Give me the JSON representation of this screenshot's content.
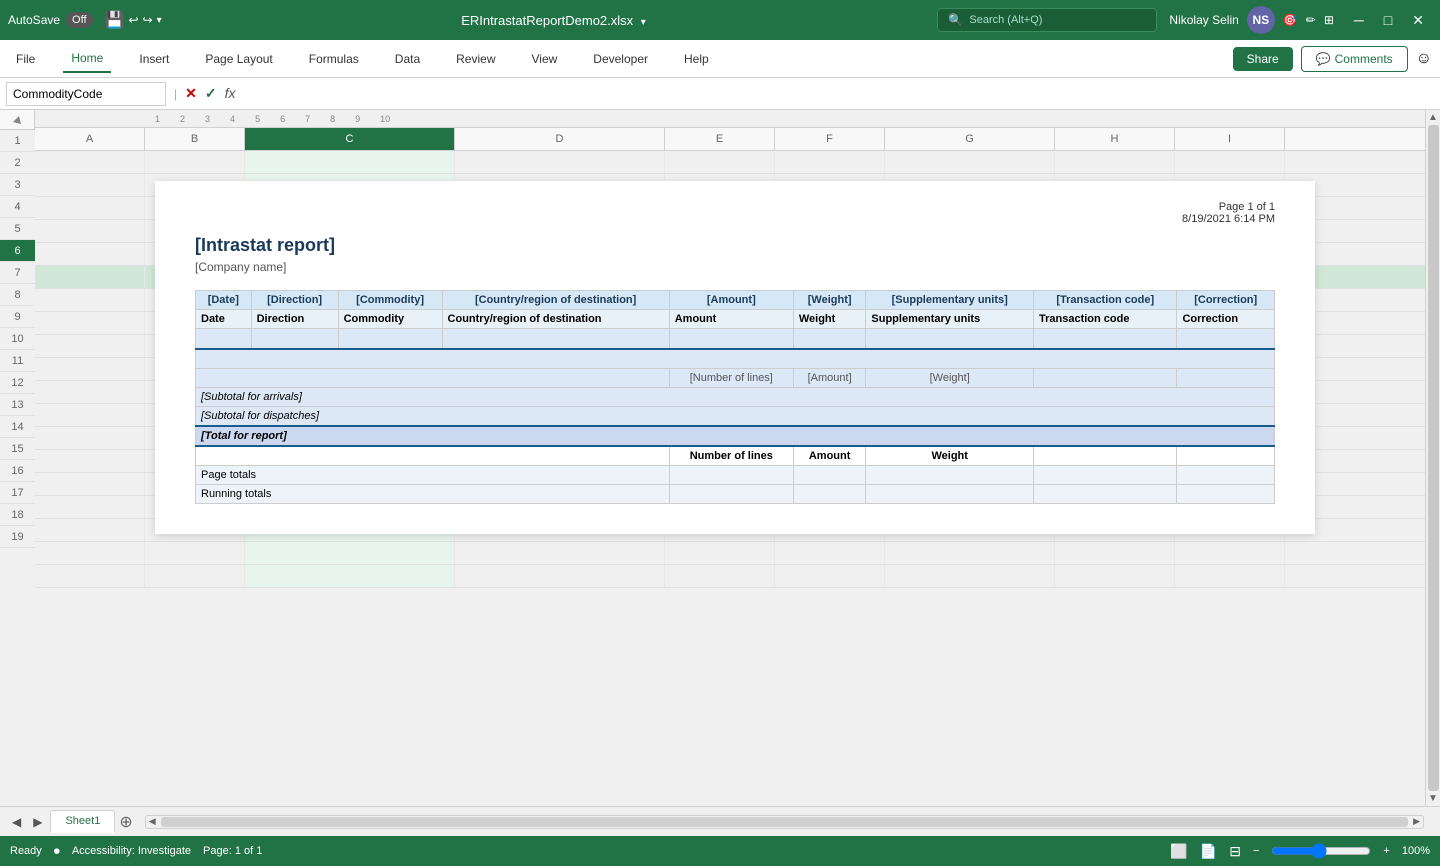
{
  "titleBar": {
    "autosave_label": "AutoSave",
    "autosave_state": "Off",
    "filename": "ERIntrastatReportDemo2.xlsx",
    "search_placeholder": "Search (Alt+Q)",
    "user_name": "Nikolay Selin",
    "user_initials": "NS"
  },
  "ribbon": {
    "tabs": [
      "File",
      "Home",
      "Insert",
      "Page Layout",
      "Formulas",
      "Data",
      "Review",
      "View",
      "Developer",
      "Help"
    ],
    "active_tab": "Home",
    "share_label": "Share",
    "comments_label": "Comments"
  },
  "formulaBar": {
    "name_box": "CommodityCode",
    "formula_content": "fx"
  },
  "columns": {
    "headers": [
      "A",
      "B",
      "C",
      "D",
      "E",
      "F",
      "G",
      "H",
      "I"
    ],
    "widths": [
      110,
      100,
      210,
      210,
      110,
      110,
      170,
      120,
      110
    ]
  },
  "rows": {
    "numbers": [
      1,
      2,
      3,
      4,
      5,
      6,
      7,
      8,
      9,
      10,
      11,
      12,
      13,
      14,
      15,
      16,
      17,
      18,
      19
    ],
    "active_row": 6
  },
  "document": {
    "page_info": "Page 1 of  1",
    "date_info": "8/19/2021 6:14 PM",
    "title": "[Intrastat report]",
    "company": "[Company name]",
    "table_header1": {
      "date": "[Date]",
      "direction": "[Direction]",
      "commodity": "[Commodity]",
      "country": "[Country/region of destination]",
      "amount": "[Amount]",
      "weight": "[Weight]",
      "supplementary": "[Supplementary units]",
      "transaction_code": "[Transaction code]",
      "correction": "[Correction]"
    },
    "table_header2": {
      "date": "Date",
      "direction": "Direction",
      "commodity": "Commodity",
      "country": "Country/region of destination",
      "amount": "Amount",
      "weight": "Weight",
      "supplementary": "Supplementary units",
      "transaction_code": "Transaction code",
      "correction": "Correction"
    },
    "subtotals": {
      "number_of_lines": "[Number of lines]",
      "amount": "[Amount]",
      "weight": "[Weight]",
      "arrivals": "[Subtotal for arrivals]",
      "dispatches": "[Subtotal for dispatches]",
      "total": "[Total for report]"
    },
    "summary": {
      "number_of_lines": "Number of lines",
      "amount": "Amount",
      "weight": "Weight",
      "page_totals": "Page totals",
      "running_totals": "Running totals"
    }
  },
  "statusBar": {
    "ready": "Ready",
    "accessibility": "Accessibility: Investigate",
    "page_info": "Page: 1 of 1",
    "zoom": "100%"
  },
  "sheetTabs": {
    "tabs": [
      "Sheet1"
    ],
    "active": "Sheet1"
  },
  "icons": {
    "save": "💾",
    "undo": "↩",
    "redo": "↪",
    "search": "🔍",
    "help": "❓",
    "share": "↗",
    "comments": "💬",
    "close": "✕",
    "minimize": "─",
    "maximize": "□",
    "check": "✓",
    "cross": "✕",
    "normal_view": "⬜",
    "page_layout_view": "📄",
    "page_break_view": "⊟",
    "zoom_out": "−",
    "zoom_in": "+"
  }
}
